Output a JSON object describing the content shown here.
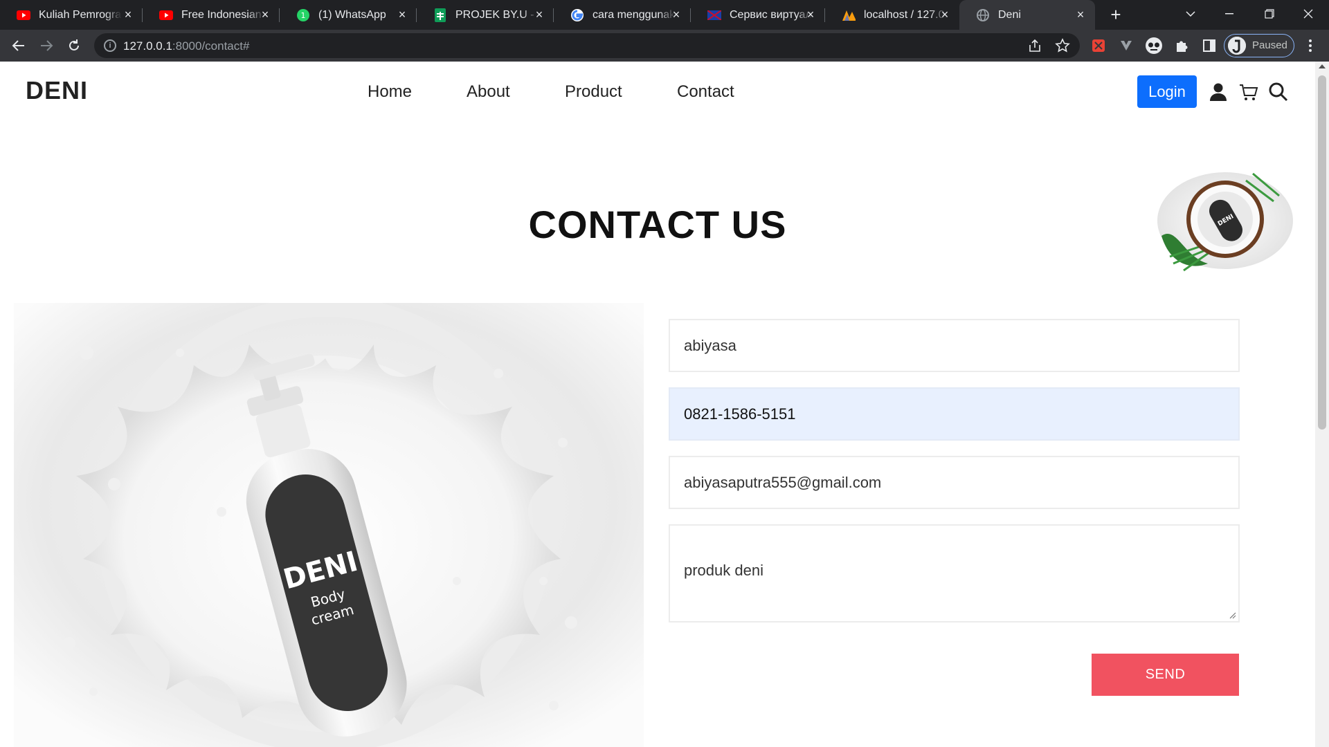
{
  "browser": {
    "tabs": [
      {
        "title": "Kuliah Pemrograman",
        "icon": "youtube-icon"
      },
      {
        "title": "Free Indonesian V",
        "icon": "youtube-icon"
      },
      {
        "title": "(1) WhatsApp",
        "icon": "whatsapp-icon"
      },
      {
        "title": "PROJEK BY.U - Go",
        "icon": "sheets-icon"
      },
      {
        "title": "cara menggunakan",
        "icon": "google-icon"
      },
      {
        "title": "Сервис виртуаль",
        "icon": "flag-icon"
      },
      {
        "title": "localhost / 127.0.0",
        "icon": "phpmyadmin-icon"
      },
      {
        "title": "Deni",
        "icon": "globe-icon"
      }
    ],
    "url_host": "127.0.0.1",
    "url_rest": ":8000/contact#",
    "profile_status": "Paused"
  },
  "site": {
    "logo": "DENI",
    "nav": [
      "Home",
      "About",
      "Product",
      "Contact"
    ],
    "login_label": "Login",
    "heading": "CONTACT US",
    "bottle_brand": "DENI",
    "bottle_line1": "Body",
    "bottle_line2": "cream",
    "form": {
      "name": "abiyasa",
      "phone": "0821-1586-5151",
      "email": "abiyasaputra555@gmail.com",
      "message": "produk deni",
      "send_label": "SEND"
    }
  },
  "colors": {
    "accent": "#0d6efd",
    "send": "#f15260",
    "autofill": "#e8f0fe"
  }
}
